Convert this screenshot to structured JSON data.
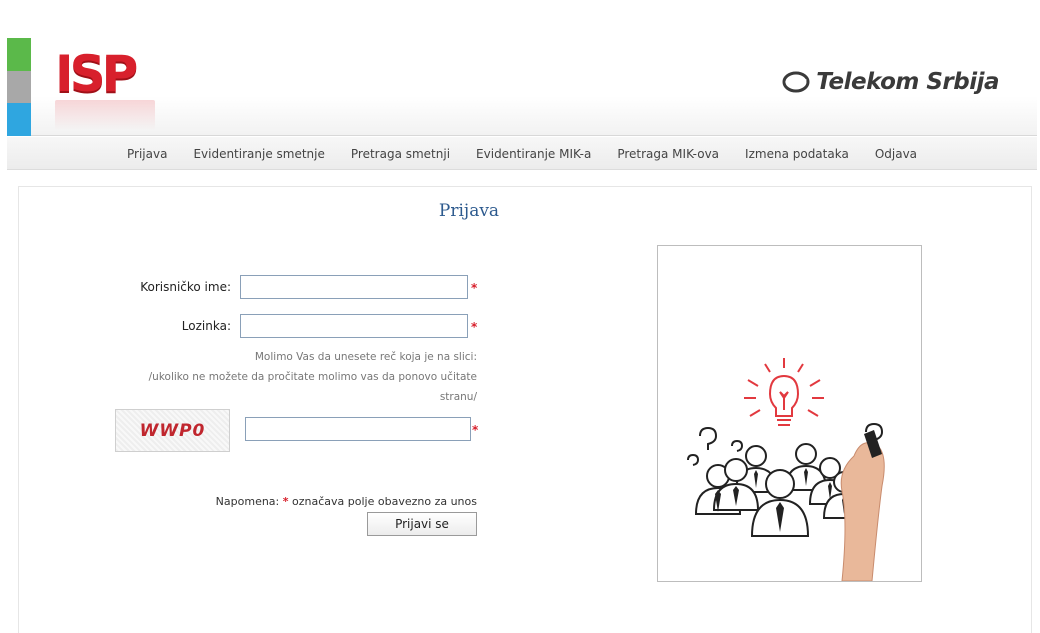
{
  "header": {
    "logo_text": "ISP",
    "brand_text": "Telekom Srbija",
    "stripe_colors": [
      "#5bb94a",
      "#a8a8a8",
      "#2fa6e0"
    ]
  },
  "nav": {
    "items": [
      {
        "label": "Prijava"
      },
      {
        "label": "Evidentiranje smetnje"
      },
      {
        "label": "Pretraga smetnji"
      },
      {
        "label": "Evidentiranje MIK-a"
      },
      {
        "label": "Pretraga MIK-ova"
      },
      {
        "label": "Izmena podataka"
      },
      {
        "label": "Odjava"
      }
    ]
  },
  "form": {
    "title": "Prijava",
    "username_label": "Korisničko ime:",
    "username_value": "",
    "password_label": "Lozinka:",
    "password_value": "",
    "required_mark": "*",
    "hint_line1": "Molimo Vas da unesete reč koja je na slici:",
    "hint_line2": "/ukoliko ne možete da pročitate molimo vas da ponovo učitate",
    "hint_line3": "stranu/",
    "captcha_text": "WWP0",
    "captcha_value": "",
    "note_prefix": "Napomena:",
    "note_suffix": "označava polje obavezno za unos",
    "submit_label": "Prijavi se"
  },
  "colors": {
    "accent_red": "#d8202c",
    "title_blue": "#2d5a8e"
  },
  "illustration": {
    "icon": "team-idea-lightbulb-illustration"
  }
}
